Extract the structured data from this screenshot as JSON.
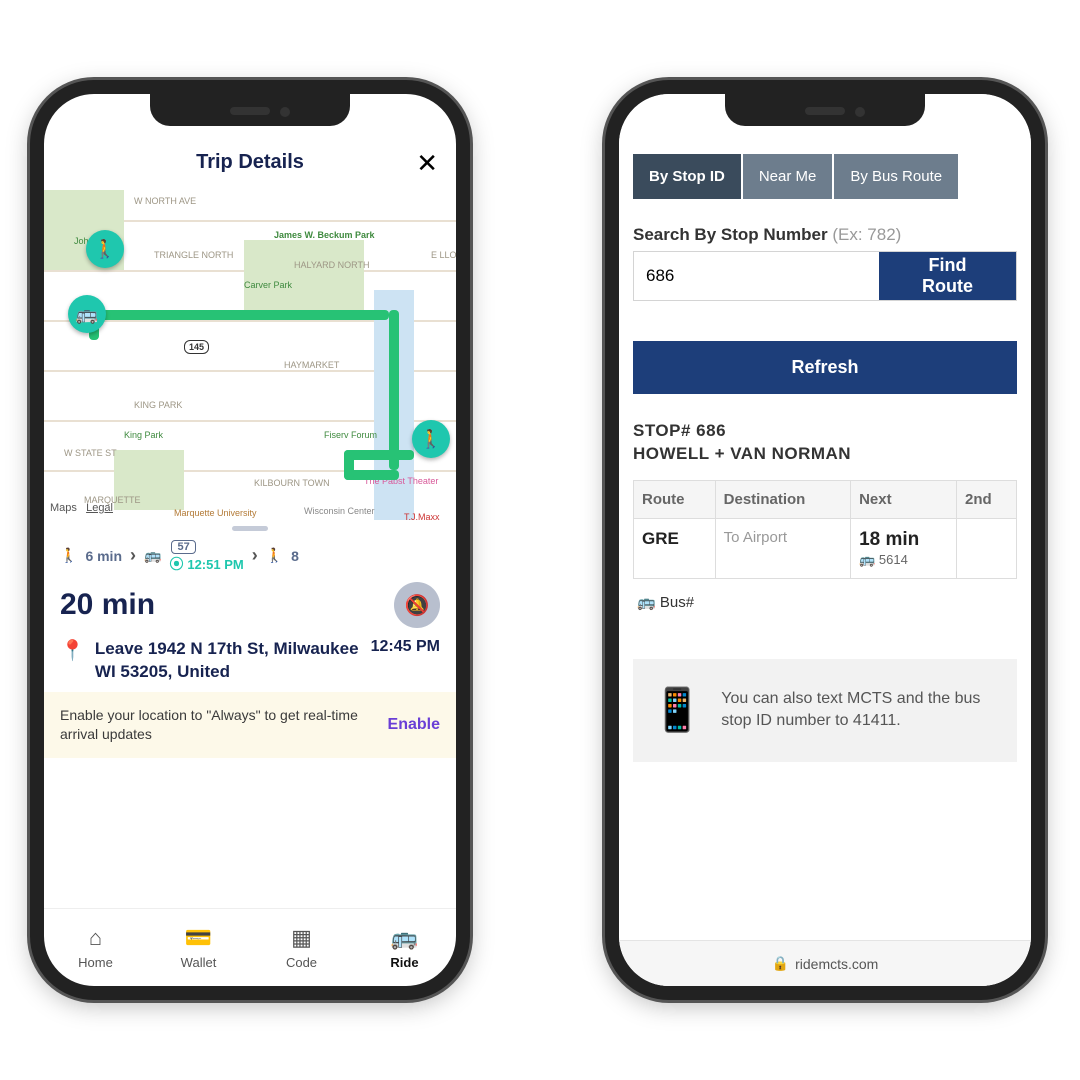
{
  "left": {
    "title": "Trip Details",
    "map": {
      "labels": [
        "W NORTH AVE",
        "James W. Beckum Park",
        "TRIANGLE NORTH",
        "HALYARD NORTH",
        "Johns Park",
        "Carver Park",
        "145",
        "HAYMARKET",
        "KING PARK",
        "King Park",
        "Fiserv Forum",
        "W STATE ST",
        "KILBOURN TOWN",
        "The Pabst Theater",
        "MARQUETTE",
        "Marquette University",
        "Wisconsin Center",
        "T.J.Maxx",
        "E LLO"
      ],
      "attribution_left": "Maps",
      "attribution_legal": "Legal"
    },
    "steps": {
      "walk1": "6 min",
      "bus_route": "57",
      "bus_time": "12:51 PM",
      "walk2": "8"
    },
    "total": "20 min",
    "leave": {
      "address": "Leave 1942 N 17th St, Milwaukee WI 53205, United",
      "time": "12:45 PM"
    },
    "banner": {
      "msg": "Enable your location to \"Always\" to get real-time arrival updates",
      "action": "Enable"
    },
    "tabs": [
      "Home",
      "Wallet",
      "Code",
      "Ride"
    ]
  },
  "right": {
    "tabs": [
      "By Stop ID",
      "Near Me",
      "By Bus Route"
    ],
    "search": {
      "label_bold": "Search By Stop Number",
      "example": "(Ex: 782)",
      "value": "686",
      "button": "Find Route"
    },
    "refresh": "Refresh",
    "stop": {
      "line1": "STOP# 686",
      "line2": "HOWELL + VAN NORMAN"
    },
    "table": {
      "headers": [
        "Route",
        "Destination",
        "Next",
        "2nd"
      ],
      "row": {
        "route": "GRE",
        "dest": "To Airport",
        "next_time": "18 min",
        "next_veh": "5614",
        "second": ""
      }
    },
    "busnum_label": "Bus#",
    "tip": "You can also text MCTS and the bus stop ID number to 41411.",
    "url": "ridemcts.com"
  }
}
